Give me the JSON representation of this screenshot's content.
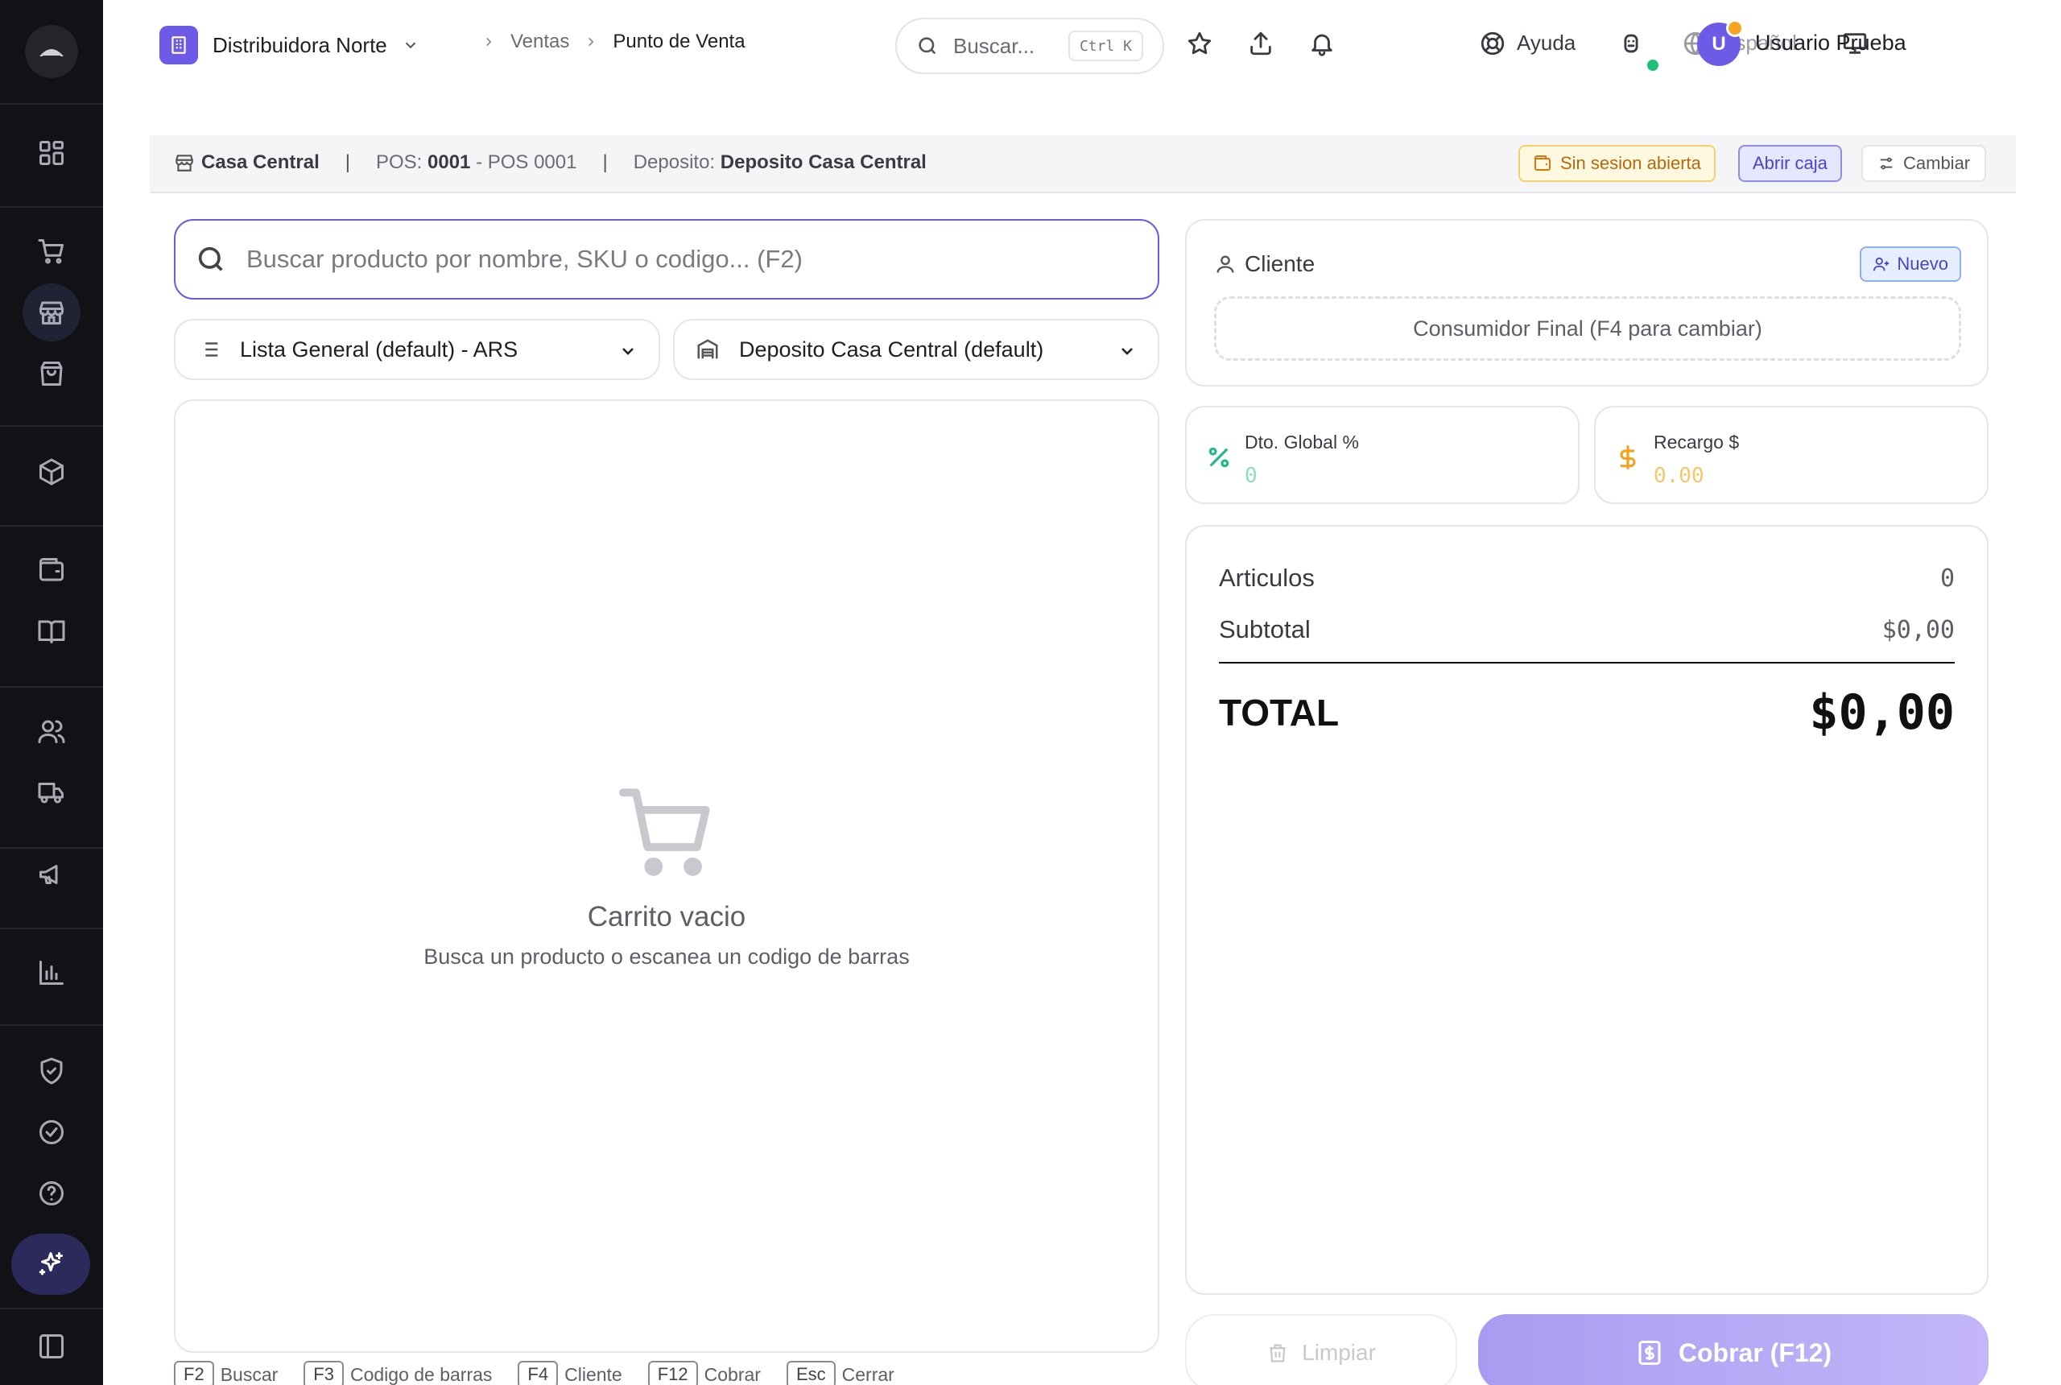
{
  "topbar": {
    "org_name": "Distribuidora Norte",
    "breadcrumb": [
      "Ventas",
      "Punto de Venta"
    ],
    "search_placeholder": "Buscar...",
    "search_shortcut": "Ctrl K",
    "help_label": "Ayuda",
    "language_label": "Español",
    "user_initial": "U",
    "user_name": "Usuario Prueba"
  },
  "sidebar": {
    "icons": [
      "dashboard-icon",
      "cart-icon",
      "store-icon",
      "shopping-bag-icon",
      "package-icon",
      "wallet-icon",
      "book-icon",
      "users-icon",
      "truck-icon",
      "megaphone-icon",
      "chart-icon",
      "shield-icon",
      "check-circle-icon",
      "help-circle-icon",
      "sparkles-icon",
      "panel-icon"
    ],
    "active": "store-icon"
  },
  "infobar": {
    "branch": "Casa Central",
    "pos_label": "POS:",
    "pos_code": "0001",
    "pos_name": "- POS 0001",
    "deposit_label": "Deposito:",
    "deposit_name": "Deposito Casa Central",
    "session_badge": "Sin sesion abierta",
    "open_button": "Abrir caja",
    "change_button": "Cambiar"
  },
  "products": {
    "search_placeholder": "Buscar producto por nombre, SKU o codigo... (F2)",
    "price_list": "Lista General (default) - ARS",
    "warehouse": "Deposito Casa Central (default)",
    "empty_title": "Carrito vacio",
    "empty_subtitle": "Busca un producto o escanea un codigo de barras"
  },
  "shortcuts": [
    {
      "key": "F2",
      "label": "Buscar"
    },
    {
      "key": "F3",
      "label": "Codigo de barras"
    },
    {
      "key": "F4",
      "label": "Cliente"
    },
    {
      "key": "F12",
      "label": "Cobrar"
    },
    {
      "key": "Esc",
      "label": "Cerrar"
    }
  ],
  "client": {
    "title": "Cliente",
    "new_button": "Nuevo",
    "selected": "Consumidor Final (F4 para cambiar)"
  },
  "adjustments": {
    "discount_label": "Dto. Global %",
    "discount_value": "0",
    "surcharge_label": "Recargo $",
    "surcharge_value": "0.00"
  },
  "totals": {
    "items_label": "Articulos",
    "items_value": "0",
    "subtotal_label": "Subtotal",
    "subtotal_value": "$0,00",
    "total_label": "TOTAL",
    "total_value": "$0,00"
  },
  "actions": {
    "clear_button": "Limpiar",
    "pay_button": "Cobrar (F12)"
  },
  "colors": {
    "accent": "#6d5ae6",
    "discount": "#21b88a",
    "surcharge": "#f0a422",
    "sidebar_bg": "#111116"
  }
}
